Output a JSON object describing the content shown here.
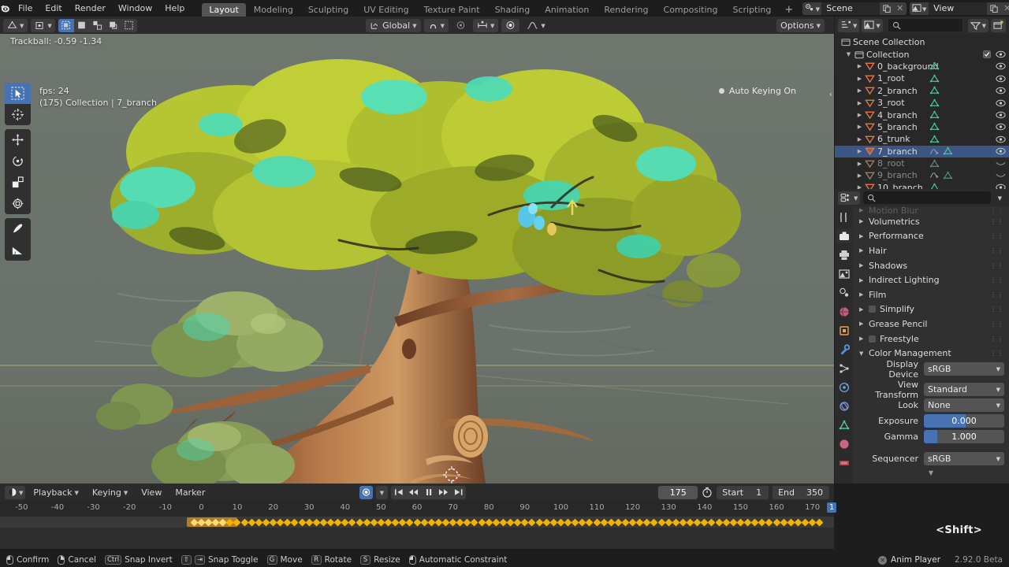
{
  "topbar": {
    "menus": [
      "File",
      "Edit",
      "Render",
      "Window",
      "Help"
    ],
    "workspace_tabs": [
      {
        "label": "Layout",
        "active": true
      },
      {
        "label": "Modeling",
        "active": false
      },
      {
        "label": "Sculpting",
        "active": false
      },
      {
        "label": "UV Editing",
        "active": false
      },
      {
        "label": "Texture Paint",
        "active": false
      },
      {
        "label": "Shading",
        "active": false
      },
      {
        "label": "Animation",
        "active": false
      },
      {
        "label": "Rendering",
        "active": false
      },
      {
        "label": "Compositing",
        "active": false
      },
      {
        "label": "Scripting",
        "active": false
      },
      {
        "label": "+",
        "active": false
      }
    ],
    "scene_field": "Scene",
    "viewlayer_field": "View Layer"
  },
  "viewport_header": {
    "transform_orientation": "Global",
    "options_label": "Options"
  },
  "viewport": {
    "trackball": "Trackball: -0.59 -1.34",
    "fps": "fps: 24",
    "frame_info": "(175) Collection | 7_branch",
    "auto_keying": "Auto Keying On",
    "background_color": "#6b736c",
    "grid_color": "#b4b478"
  },
  "toolbar": {
    "tools": [
      {
        "name": "tweak-tool",
        "active": true
      },
      {
        "name": "cursor-tool",
        "active": false
      },
      {
        "name": "move-tool",
        "active": false
      },
      {
        "name": "rotate-tool",
        "active": false
      },
      {
        "name": "scale-tool",
        "active": false
      },
      {
        "name": "transform-tool",
        "active": false
      },
      {
        "name": "annotate-tool",
        "active": false
      },
      {
        "name": "measure-tool",
        "active": false
      }
    ]
  },
  "outliner": {
    "root": "Scene Collection",
    "collection": "Collection",
    "items": [
      {
        "label": "0_background",
        "selected": false,
        "hidden": false,
        "anim": false
      },
      {
        "label": "1_root",
        "selected": false,
        "hidden": false,
        "anim": false
      },
      {
        "label": "2_branch",
        "selected": false,
        "hidden": false,
        "anim": false
      },
      {
        "label": "3_root",
        "selected": false,
        "hidden": false,
        "anim": false
      },
      {
        "label": "4_branch",
        "selected": false,
        "hidden": false,
        "anim": false
      },
      {
        "label": "5_branch",
        "selected": false,
        "hidden": false,
        "anim": false
      },
      {
        "label": "6_trunk",
        "selected": false,
        "hidden": false,
        "anim": false
      },
      {
        "label": "7_branch",
        "selected": true,
        "hidden": false,
        "anim": true
      },
      {
        "label": "8_root",
        "selected": false,
        "hidden": true,
        "anim": false
      },
      {
        "label": "9_branch",
        "selected": false,
        "hidden": true,
        "anim": true
      },
      {
        "label": "10_branch",
        "selected": false,
        "hidden": false,
        "anim": false
      }
    ]
  },
  "properties": {
    "panels": [
      {
        "label": "Motion Blur",
        "open": false,
        "checkbox": false,
        "partial": true
      },
      {
        "label": "Volumetrics",
        "open": false,
        "checkbox": false
      },
      {
        "label": "Performance",
        "open": false,
        "checkbox": false
      },
      {
        "label": "Hair",
        "open": false,
        "checkbox": false
      },
      {
        "label": "Shadows",
        "open": false,
        "checkbox": false
      },
      {
        "label": "Indirect Lighting",
        "open": false,
        "checkbox": false
      },
      {
        "label": "Film",
        "open": false,
        "checkbox": false
      },
      {
        "label": "Simplify",
        "open": false,
        "checkbox": true
      },
      {
        "label": "Grease Pencil",
        "open": false,
        "checkbox": false
      },
      {
        "label": "Freestyle",
        "open": false,
        "checkbox": true
      },
      {
        "label": "Color Management",
        "open": true,
        "checkbox": false
      }
    ],
    "color_management": {
      "display_device_label": "Display Device",
      "display_device_value": "sRGB",
      "view_transform_label": "View Transform",
      "view_transform_value": "Standard",
      "look_label": "Look",
      "look_value": "None",
      "exposure_label": "Exposure",
      "exposure_value": "0.000",
      "exposure_fill_pct": 52,
      "gamma_label": "Gamma",
      "gamma_value": "1.000",
      "gamma_fill_pct": 17,
      "sequencer_label": "Sequencer",
      "sequencer_value": "sRGB"
    }
  },
  "timeline": {
    "menus": [
      "Playback",
      "Keying",
      "View",
      "Marker"
    ],
    "current_frame": "175",
    "start_label": "Start",
    "start_value": "1",
    "end_label": "End",
    "end_value": "350",
    "ticks": [
      -50,
      -40,
      -30,
      -20,
      -10,
      0,
      10,
      20,
      30,
      40,
      50,
      60,
      70,
      80,
      90,
      100,
      110,
      120,
      130,
      140,
      150,
      160,
      170
    ],
    "playhead_label": "1"
  },
  "statusbar": {
    "items": [
      {
        "key": "mouse-left",
        "label": "Confirm"
      },
      {
        "key": "mouse-right",
        "label": "Cancel"
      },
      {
        "key": "Ctrl",
        "label": "Snap Invert"
      },
      {
        "key": "Shift2",
        "label": "Snap Toggle"
      },
      {
        "key": "G",
        "label": "Move"
      },
      {
        "key": "R",
        "label": "Rotate"
      },
      {
        "key": "S",
        "label": "Resize"
      },
      {
        "key": "mouse-mid",
        "label": "Automatic Constraint"
      }
    ],
    "anim_player": "Anim Player",
    "version": "2.92.0 Beta"
  },
  "overlay": {
    "shift_hint": "<Shift>"
  },
  "colors": {
    "accent": "#4772b3",
    "keyframe": "#f2b200",
    "panel_bg": "#303030",
    "header_bg": "#2b2b2b",
    "outliner_bg": "#282828",
    "selection": "#3b5584"
  }
}
